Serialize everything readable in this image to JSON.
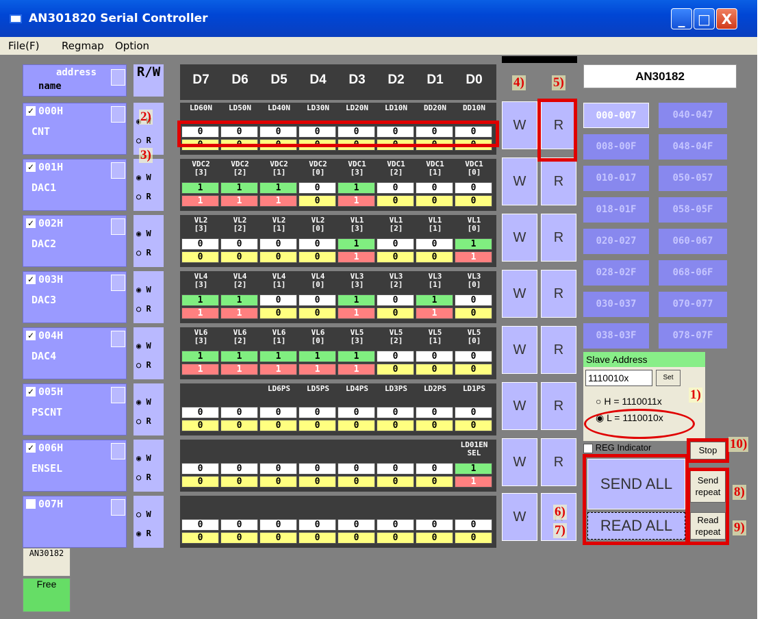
{
  "window": {
    "title": "AN301820 Serial Controller",
    "minimize": "_",
    "maximize": "□",
    "close": "X"
  },
  "menu": [
    "File(F)",
    "Regmap",
    "Option"
  ],
  "header": {
    "address": "address",
    "name": "name",
    "rw": "R/W",
    "bits": [
      "D7",
      "D6",
      "D5",
      "D4",
      "D3",
      "D2",
      "D1",
      "D0"
    ],
    "chip": "AN30182"
  },
  "callouts": [
    "1)",
    "2)",
    "3)",
    "4)",
    "5)",
    "6)",
    "7)",
    "8)",
    "9)",
    "10)"
  ],
  "registers": [
    {
      "code": "000H",
      "name": "CNT",
      "checked": true,
      "mode": "W",
      "bitnames": [
        "LD60N",
        "LD50N",
        "LD40N",
        "LD30N",
        "LD20N",
        "LD10N",
        "DD20N",
        "DD10N"
      ],
      "write": [
        "0",
        "0",
        "0",
        "0",
        "0",
        "0",
        "0",
        "0"
      ],
      "read": [
        "0",
        "0",
        "0",
        "0",
        "0",
        "0",
        "0",
        "0"
      ]
    },
    {
      "code": "001H",
      "name": "DAC1",
      "checked": true,
      "mode": "W",
      "bitnames": [
        "VDC2\n[3]",
        "VDC2\n[2]",
        "VDC2\n[1]",
        "VDC2\n[0]",
        "VDC1\n[3]",
        "VDC1\n[2]",
        "VDC1\n[1]",
        "VDC1\n[0]"
      ],
      "write": [
        "1",
        "1",
        "1",
        "0",
        "1",
        "0",
        "0",
        "0"
      ],
      "read": [
        "1",
        "1",
        "1",
        "0",
        "1",
        "0",
        "0",
        "0"
      ]
    },
    {
      "code": "002H",
      "name": "DAC2",
      "checked": true,
      "mode": "W",
      "bitnames": [
        "VL2\n[3]",
        "VL2\n[2]",
        "VL2\n[1]",
        "VL2\n[0]",
        "VL1\n[3]",
        "VL1\n[2]",
        "VL1\n[1]",
        "VL1\n[0]"
      ],
      "write": [
        "0",
        "0",
        "0",
        "0",
        "1",
        "0",
        "0",
        "1"
      ],
      "read": [
        "0",
        "0",
        "0",
        "0",
        "1",
        "0",
        "0",
        "1"
      ]
    },
    {
      "code": "003H",
      "name": "DAC3",
      "checked": true,
      "mode": "W",
      "bitnames": [
        "VL4\n[3]",
        "VL4\n[2]",
        "VL4\n[1]",
        "VL4\n[0]",
        "VL3\n[3]",
        "VL3\n[2]",
        "VL3\n[1]",
        "VL3\n[0]"
      ],
      "write": [
        "1",
        "1",
        "0",
        "0",
        "1",
        "0",
        "1",
        "0"
      ],
      "read": [
        "1",
        "1",
        "0",
        "0",
        "1",
        "0",
        "1",
        "0"
      ]
    },
    {
      "code": "004H",
      "name": "DAC4",
      "checked": true,
      "mode": "W",
      "bitnames": [
        "VL6\n[3]",
        "VL6\n[2]",
        "VL6\n[1]",
        "VL6\n[0]",
        "VL5\n[3]",
        "VL5\n[2]",
        "VL5\n[1]",
        "VL5\n[0]"
      ],
      "write": [
        "1",
        "1",
        "1",
        "1",
        "1",
        "0",
        "0",
        "0"
      ],
      "read": [
        "1",
        "1",
        "1",
        "1",
        "1",
        "0",
        "0",
        "0"
      ]
    },
    {
      "code": "005H",
      "name": "PSCNT",
      "checked": true,
      "mode": "W",
      "bitnames": [
        "",
        "",
        "LD6PS",
        "LD5PS",
        "LD4PS",
        "LD3PS",
        "LD2PS",
        "LD1PS"
      ],
      "write": [
        "0",
        "0",
        "0",
        "0",
        "0",
        "0",
        "0",
        "0"
      ],
      "read": [
        "0",
        "0",
        "0",
        "0",
        "0",
        "0",
        "0",
        "0"
      ]
    },
    {
      "code": "006H",
      "name": "ENSEL",
      "checked": true,
      "mode": "W",
      "bitnames": [
        "",
        "",
        "",
        "",
        "",
        "",
        "",
        "LD01EN\nSEL"
      ],
      "write": [
        "0",
        "0",
        "0",
        "0",
        "0",
        "0",
        "0",
        "1"
      ],
      "read": [
        "0",
        "0",
        "0",
        "0",
        "0",
        "0",
        "0",
        "1"
      ]
    },
    {
      "code": "007H",
      "name": "",
      "checked": false,
      "mode": "R",
      "bitnames": [
        "",
        "",
        "",
        "",
        "",
        "",
        "",
        ""
      ],
      "write": [
        "0",
        "0",
        "0",
        "0",
        "0",
        "0",
        "0",
        "0"
      ],
      "read": [
        "0",
        "0",
        "0",
        "0",
        "0",
        "0",
        "0",
        "0"
      ]
    }
  ],
  "radio_labels": {
    "w": "W",
    "r": "R"
  },
  "wr_buttons": {
    "w": "W",
    "r": "R"
  },
  "pages": [
    "000-007",
    "040-047",
    "008-00F",
    "048-04F",
    "010-017",
    "050-057",
    "018-01F",
    "058-05F",
    "020-027",
    "060-067",
    "028-02F",
    "068-06F",
    "030-037",
    "070-077",
    "038-03F",
    "078-07F"
  ],
  "slave": {
    "label": "Slave Address",
    "value": "1110010x",
    "set": "Set",
    "h": "H = 1110011x",
    "l": "L = 1110010x",
    "selected": "L"
  },
  "reg_indicator": "REG Indicator",
  "buttons": {
    "stop": "Stop",
    "send_all": "SEND ALL",
    "send_repeat": "Send repeat",
    "read_all": "READ ALL",
    "read_repeat": "Read repeat"
  },
  "bottom": {
    "chip": "AN30182",
    "status": "Free"
  }
}
